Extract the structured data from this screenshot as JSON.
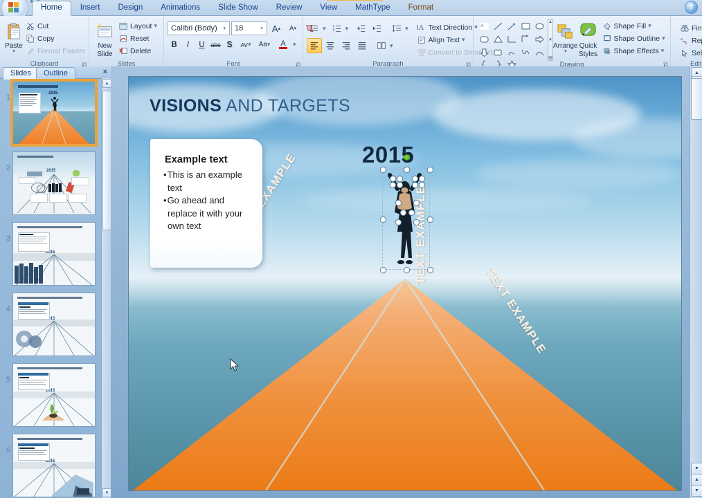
{
  "app": {
    "office_button": "office-logo",
    "help_label": "?",
    "quick_access": [
      "save-icon",
      "undo-icon",
      "redo-icon"
    ]
  },
  "ribbon": {
    "tabs": [
      {
        "label": "Home",
        "active": true
      },
      {
        "label": "Insert",
        "active": false
      },
      {
        "label": "Design",
        "active": false
      },
      {
        "label": "Animations",
        "active": false
      },
      {
        "label": "Slide Show",
        "active": false
      },
      {
        "label": "Review",
        "active": false
      },
      {
        "label": "View",
        "active": false
      },
      {
        "label": "MathType",
        "active": false
      },
      {
        "label": "Format",
        "active": false,
        "contextual": true
      }
    ],
    "groups": {
      "clipboard": {
        "label": "Clipboard",
        "paste": "Paste",
        "cut": "Cut",
        "copy": "Copy",
        "format_painter": "Format Painter"
      },
      "slides": {
        "label": "Slides",
        "new_slide_line1": "New",
        "new_slide_line2": "Slide",
        "layout": "Layout",
        "reset": "Reset",
        "delete": "Delete"
      },
      "font": {
        "label": "Font",
        "font_name": "Calibri (Body)",
        "font_size": "18",
        "grow": "A",
        "shrink": "A",
        "clear_formatting": "clear-formatting-icon",
        "bold": "B",
        "italic": "I",
        "underline": "U",
        "strikethrough": "abc",
        "shadow": "S",
        "character_spacing": "AV",
        "change_case": "Aa",
        "font_color": "A"
      },
      "paragraph": {
        "label": "Paragraph",
        "text_direction": "Text Direction",
        "align_text": "Align Text",
        "convert_to_smartart": "Convert to SmartArt"
      },
      "drawing": {
        "label": "Drawing",
        "arrange_line1": "Arrange",
        "quick_styles_line1": "Quick",
        "quick_styles_line2": "Styles",
        "shape_fill": "Shape Fill",
        "shape_outline": "Shape Outline",
        "shape_effects": "Shape Effects"
      },
      "editing": {
        "label": "Editing",
        "find": "Find",
        "replace": "Replace",
        "select": "Select"
      }
    }
  },
  "left_pane": {
    "tabs": [
      {
        "label": "Slides",
        "active": true
      },
      {
        "label": "Outline",
        "active": false
      }
    ],
    "close_label": "×",
    "slides": [
      {
        "number": "1",
        "selected": true,
        "theme": "orange"
      },
      {
        "number": "2",
        "selected": false,
        "theme": "blue"
      },
      {
        "number": "3",
        "selected": false,
        "theme": "blue"
      },
      {
        "number": "4",
        "selected": false,
        "theme": "blue"
      },
      {
        "number": "5",
        "selected": false,
        "theme": "blue"
      },
      {
        "number": "6",
        "selected": false,
        "theme": "blue"
      }
    ]
  },
  "slide": {
    "title_bold": "VISIONS",
    "title_rest": " AND TARGETS",
    "year": "2015",
    "text_box": {
      "heading": "Example text",
      "bullets": [
        "This is an example  text",
        "Go ahead and replace it with your own text"
      ]
    },
    "road_labels": [
      {
        "text": "TEXT EXAMPLE",
        "position": "left"
      },
      {
        "text": "TEXT EXAMPLE",
        "position": "center"
      },
      {
        "text": "TEXT EXAMPLE",
        "position": "right"
      }
    ],
    "selected_object": "runner-figure",
    "colors": {
      "sky": "#7fbade",
      "sea": "#5d98ae",
      "road": "#f08a33",
      "title": "#1e4d78",
      "handle": "#ffffff",
      "rotate_handle": "#6fd130"
    }
  },
  "scrollbars": {
    "up_arrow": "▲",
    "down_arrow": "▼",
    "prev_slide": "▲",
    "next_slide": "▼"
  }
}
